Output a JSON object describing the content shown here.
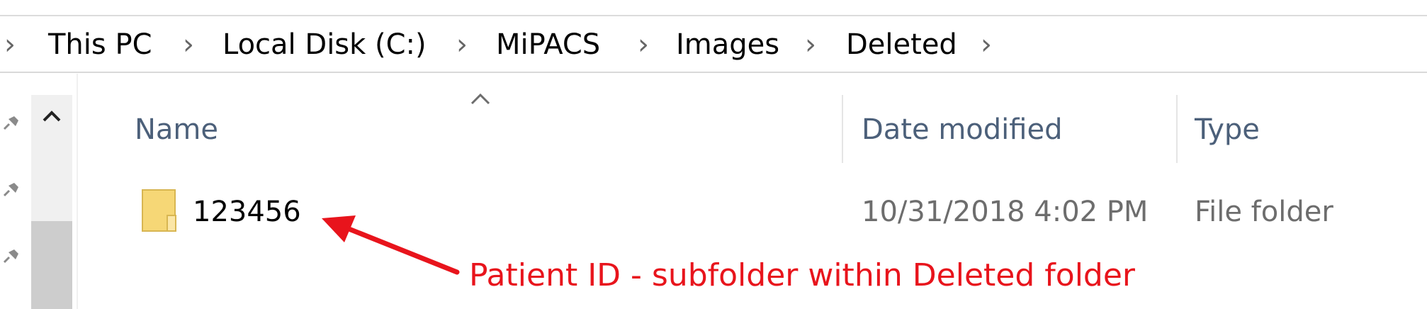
{
  "breadcrumb": {
    "items": [
      "This PC",
      "Local Disk (C:)",
      "MiPACS",
      "Images",
      "Deleted"
    ],
    "separator": "›"
  },
  "columns": {
    "name": "Name",
    "date_modified": "Date modified",
    "type": "Type"
  },
  "files": [
    {
      "name": "123456",
      "date_modified": "10/31/2018 4:02 PM",
      "type": "File folder",
      "icon": "folder-icon"
    }
  ],
  "annotation": {
    "text": "Patient ID - subfolder within Deleted folder",
    "color": "#e8141c"
  },
  "nav_pane": {
    "pins": [
      "pin-icon",
      "pin-icon",
      "pin-icon"
    ]
  },
  "colors": {
    "header_text": "#4c607a",
    "secondary_text": "#6d6d6d",
    "folder": "#f6d776"
  }
}
